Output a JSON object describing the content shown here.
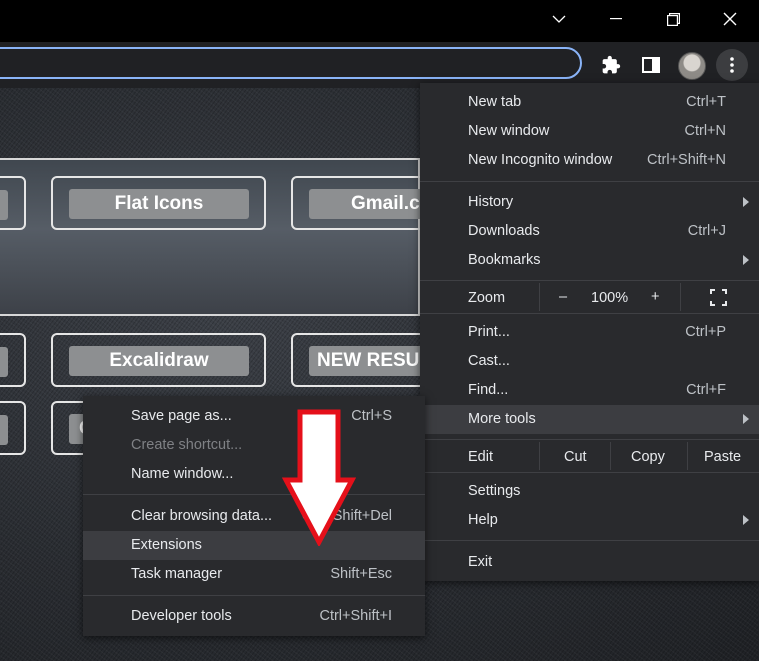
{
  "window": {
    "controls": [
      "chevron-down-icon",
      "minimize-icon",
      "restore-icon",
      "close-icon"
    ]
  },
  "page": {
    "tiles_row1": [
      "Flat Icons",
      "Gmail.co"
    ],
    "tiles_row2": [
      "Excalidraw",
      "NEW RESU"
    ],
    "tiles_row3": [
      "C"
    ]
  },
  "chrome_menu": {
    "new_tab": {
      "label": "New tab",
      "shortcut": "Ctrl+T"
    },
    "new_window": {
      "label": "New window",
      "shortcut": "Ctrl+N"
    },
    "new_incognito": {
      "label": "New Incognito window",
      "shortcut": "Ctrl+Shift+N"
    },
    "history": {
      "label": "History"
    },
    "downloads": {
      "label": "Downloads",
      "shortcut": "Ctrl+J"
    },
    "bookmarks": {
      "label": "Bookmarks"
    },
    "zoom": {
      "label": "Zoom",
      "minus": "–",
      "value": "100%",
      "plus": "+"
    },
    "print": {
      "label": "Print...",
      "shortcut": "Ctrl+P"
    },
    "cast": {
      "label": "Cast..."
    },
    "find": {
      "label": "Find...",
      "shortcut": "Ctrl+F"
    },
    "more_tools": {
      "label": "More tools"
    },
    "edit": {
      "label": "Edit",
      "cut": "Cut",
      "copy": "Copy",
      "paste": "Paste"
    },
    "settings": {
      "label": "Settings"
    },
    "help": {
      "label": "Help"
    },
    "exit": {
      "label": "Exit"
    }
  },
  "more_tools_menu": {
    "save_page": {
      "label": "Save page as...",
      "shortcut": "Ctrl+S"
    },
    "create_shortcut": {
      "label": "Create shortcut..."
    },
    "name_window": {
      "label": "Name window..."
    },
    "clear_browsing": {
      "label": "Clear browsing data...",
      "shortcut": "Ctrl+Shift+Del"
    },
    "extensions": {
      "label": "Extensions"
    },
    "task_manager": {
      "label": "Task manager",
      "shortcut": "Shift+Esc"
    },
    "developer_tools": {
      "label": "Developer tools",
      "shortcut": "Ctrl+Shift+I"
    }
  },
  "colors": {
    "accent": "#8ab4f8",
    "menu_bg": "#292a2d",
    "highlight": "#3c3d41",
    "annotation_arrow": "#e5101a"
  }
}
